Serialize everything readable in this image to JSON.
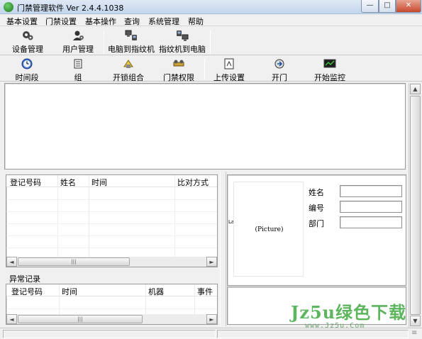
{
  "window": {
    "title": "门禁管理软件  Ver 2.4.4.1038",
    "min_glyph": "—",
    "max_glyph": "□",
    "close_glyph": "✕"
  },
  "menu": [
    "基本设置",
    "门禁设置",
    "基本操作",
    "查询",
    "系统管理",
    "帮助"
  ],
  "toolbar1": [
    {
      "label": "设备管理",
      "icon": "device-gear-icon"
    },
    {
      "label": "用户管理",
      "icon": "user-gear-icon"
    },
    {
      "label": "电脑到指纹机",
      "icon": "pc-to-fingerprint-icon"
    },
    {
      "label": "指纹机到电脑",
      "icon": "fingerprint-to-pc-icon"
    }
  ],
  "toolbar2": [
    {
      "label": "时间段",
      "icon": "clock-icon"
    },
    {
      "label": "组",
      "icon": "group-icon"
    },
    {
      "label": "开锁组合",
      "icon": "unlock-combo-icon"
    },
    {
      "label": "门禁权限",
      "icon": "access-rights-icon"
    },
    {
      "label": "上传设置",
      "icon": "upload-settings-icon"
    },
    {
      "label": "开门",
      "icon": "open-door-icon"
    },
    {
      "label": "开始监控",
      "icon": "monitor-icon"
    }
  ],
  "records_grid": {
    "columns": [
      "登记号码",
      "姓名",
      "时间",
      "比对方式"
    ]
  },
  "exception_section": {
    "title": "异常记录",
    "columns": [
      "登记号码",
      "时间",
      "机器",
      "事件"
    ]
  },
  "user_info": {
    "picture_placeholder": "(Picture)",
    "left_mark": "La",
    "fields": [
      {
        "label": "姓名",
        "value": ""
      },
      {
        "label": "编号",
        "value": ""
      },
      {
        "label": "部门",
        "value": ""
      }
    ]
  },
  "scroll_glyphs": {
    "up": "▲",
    "down": "▼",
    "left": "◄",
    "right": "►",
    "grip": "|||",
    "vgrip": "≡"
  },
  "watermark": {
    "text": "Jz5u绿色下载",
    "url": "www.Jz5u.Com"
  },
  "colors": {
    "watermark": "#3aa53a",
    "close_button": "#c7472b"
  }
}
